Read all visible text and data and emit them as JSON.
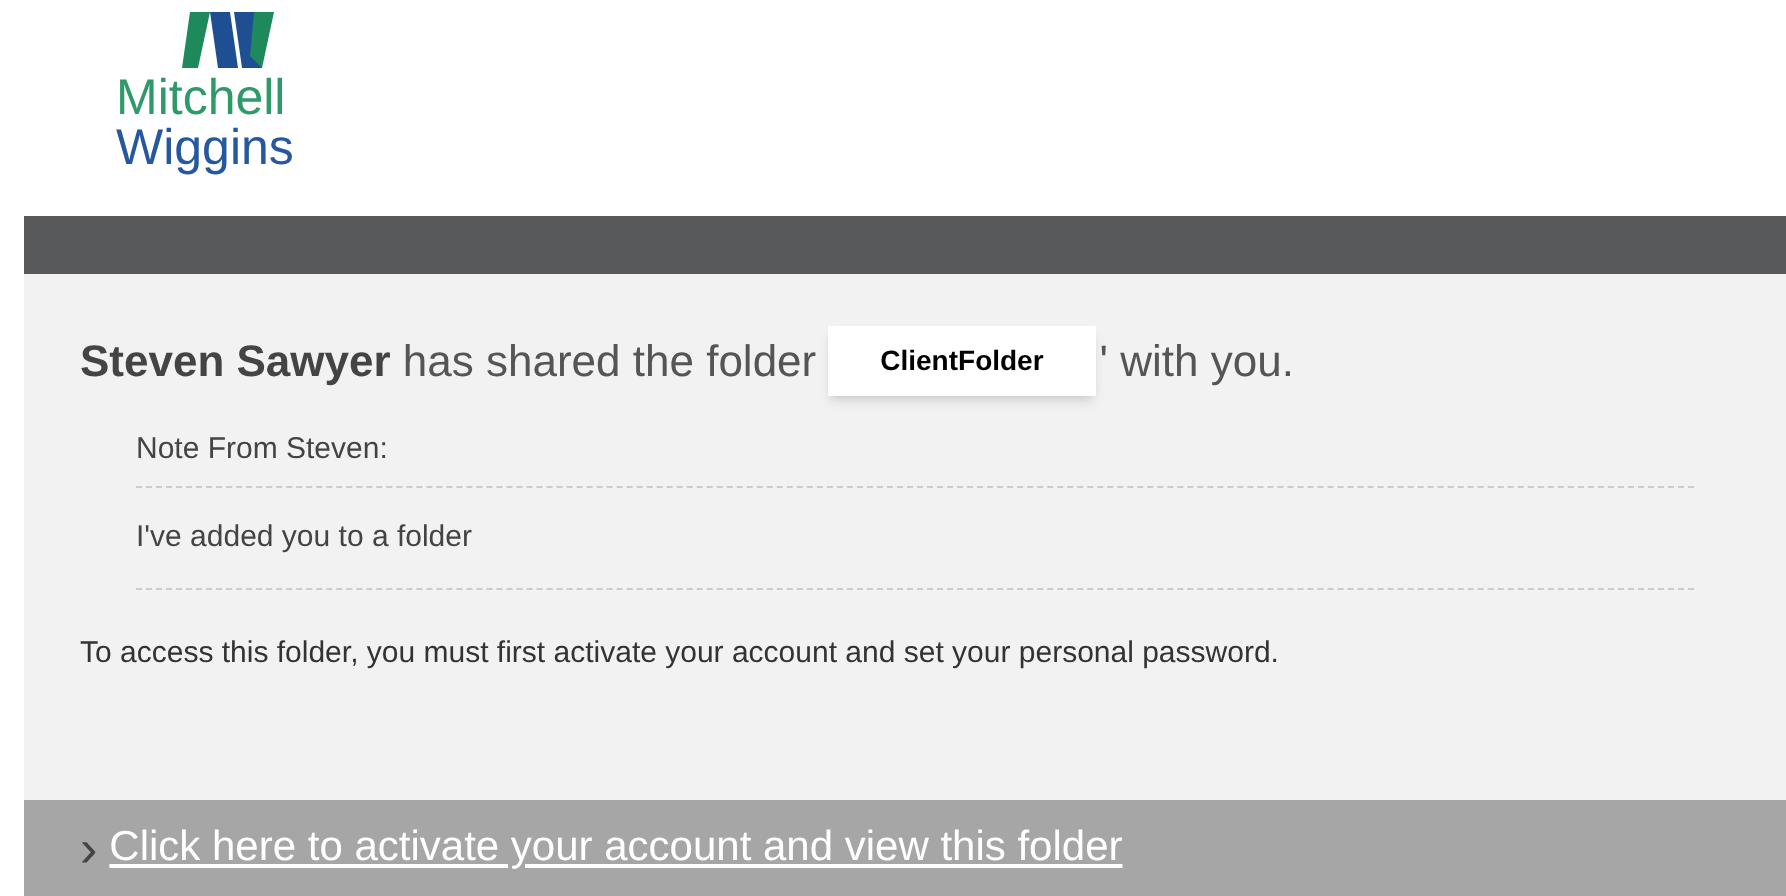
{
  "logo": {
    "line_1": "Mitchell",
    "line_2": "Wiggins"
  },
  "message": {
    "headline_before": "**Steven Sawyer** has shared the folder",
    "folder_name": "ClientFolder",
    "headline_after": "' with you.",
    "note_label": "Note From Steven:",
    "note_text": "I've added you to a folder",
    "instructions": "To access this folder, you must first activate your account and set your personal password."
  },
  "action": {
    "chevron": "›",
    "link": "Click here to activate your account and view this folder"
  }
}
